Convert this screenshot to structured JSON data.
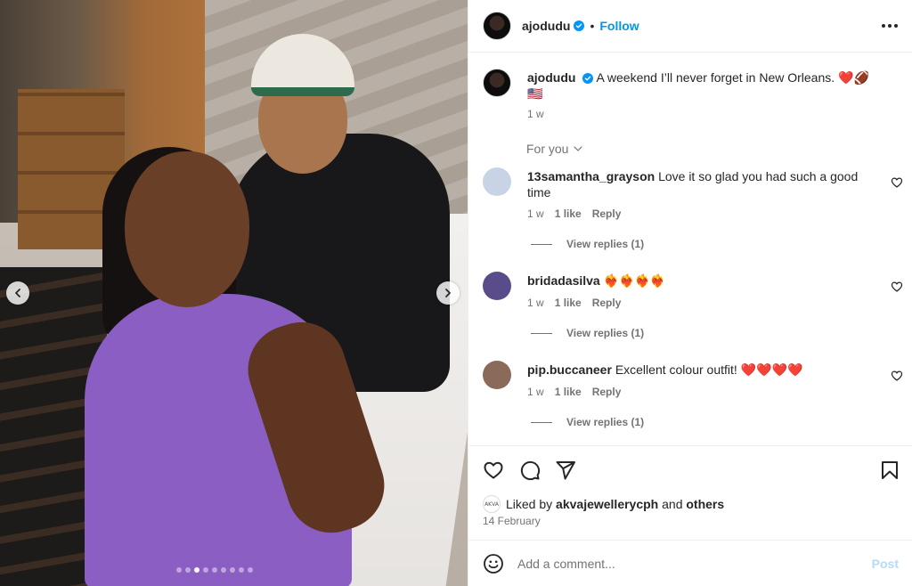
{
  "post": {
    "author": "ajodudu",
    "follow_label": "Follow",
    "separator": "•",
    "caption": "A weekend I’ll never forget in New Orleans. ❤️🏈🇺🇸",
    "caption_time": "1 w",
    "for_you_label": "For you",
    "carousel": {
      "slide_count": 9,
      "active_slide": 3
    }
  },
  "comments": [
    {
      "username": "13samantha_grayson",
      "text": "Love it so glad you had such a good time",
      "time": "1 w",
      "likes": "1 like",
      "reply_label": "Reply",
      "view_replies": "View replies (1)",
      "avatar_color": "#c8d4e6"
    },
    {
      "username": "bridadasilva",
      "text": "❤️‍🔥❤️‍🔥❤️‍🔥❤️‍🔥",
      "time": "1 w",
      "likes": "1 like",
      "reply_label": "Reply",
      "view_replies": "View replies (1)",
      "avatar_color": "#5a4b8a"
    },
    {
      "username": "pip.buccaneer",
      "text": "Excellent colour outfit! ❤️❤️❤️❤️",
      "time": "1 w",
      "likes": "1 like",
      "reply_label": "Reply",
      "view_replies": "View replies (1)",
      "avatar_color": "#8a6a58"
    }
  ],
  "engagement": {
    "liked_by_prefix": "Liked by",
    "liked_by_user": "akvajewellerycph",
    "liked_by_and": "and",
    "liked_by_others": "others",
    "mini_avatar_text": "AKVA",
    "date": "14 February"
  },
  "composer": {
    "placeholder": "Add a comment...",
    "post_label": "Post"
  },
  "colors": {
    "accent": "#0095f6",
    "post_disabled": "#b3dbff",
    "muted": "#737373",
    "outfit": "#8a5ec2"
  },
  "icons": [
    "verified-badge-icon",
    "more-options-icon",
    "heart-icon",
    "comment-icon",
    "share-icon",
    "bookmark-icon",
    "emoji-icon",
    "chevron-left-icon",
    "chevron-right-icon",
    "chevron-down-icon"
  ]
}
